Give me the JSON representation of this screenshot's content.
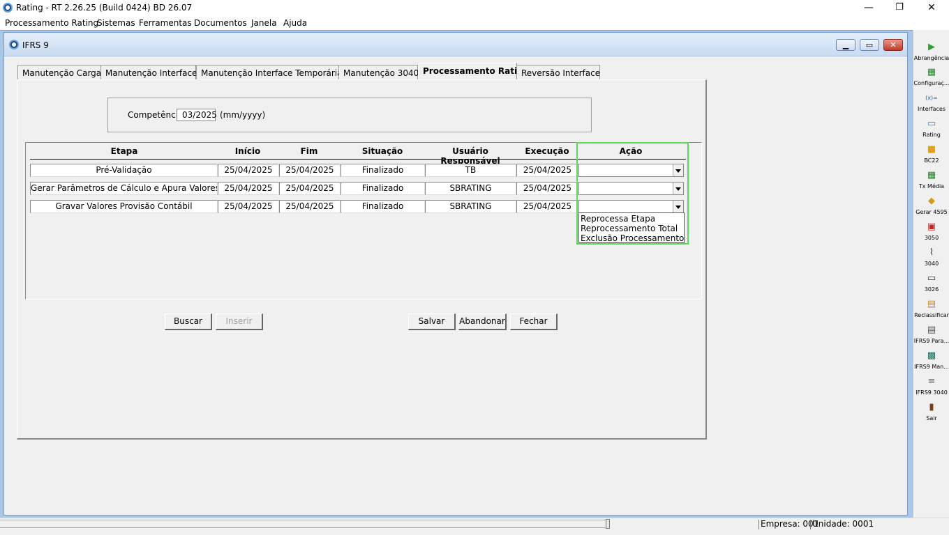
{
  "app": {
    "title": "Rating - RT 2.26.25 (Build 0424) BD 26.07",
    "minimize": "—",
    "maximize": "❐",
    "close": "✕"
  },
  "menu": [
    "Processamento Rating",
    "Sistemas",
    "Ferramentas",
    "Documentos",
    "Janela",
    "Ajuda"
  ],
  "window": {
    "title": "IFRS 9"
  },
  "tabs": [
    "Manutenção Carga",
    "Manutenção Interface",
    "Manutenção Interface Temporária",
    "Manutenção 3040",
    "Processamento Rating",
    "Reversão Interface"
  ],
  "active_tab": "Processamento Rating",
  "competencia": {
    "label": "Competência",
    "value": "03/2025",
    "hint": "(mm/yyyy)"
  },
  "grid": {
    "headers": [
      "Etapa",
      "Início",
      "Fim",
      "Situação",
      "Usuário Responsável",
      "Execução",
      "Ação"
    ],
    "rows": [
      {
        "etapa": "Pré-Validação",
        "inicio": "25/04/2025",
        "fim": "25/04/2025",
        "situacao": "Finalizado",
        "usuario": "TB",
        "execucao": "25/04/2025",
        "acao": ""
      },
      {
        "etapa": "Gerar Parâmetros de Cálculo e Apura Valores de Perda",
        "inicio": "25/04/2025",
        "fim": "25/04/2025",
        "situacao": "Finalizado",
        "usuario": "SBRATING",
        "execucao": "25/04/2025",
        "acao": ""
      },
      {
        "etapa": "Gravar Valores Provisão Contábil",
        "inicio": "25/04/2025",
        "fim": "25/04/2025",
        "situacao": "Finalizado",
        "usuario": "SBRATING",
        "execucao": "25/04/2025",
        "acao": ""
      }
    ],
    "dropdown_options": [
      "Reprocessa Etapa",
      "Reprocessamento Total",
      "Exclusão Processamento"
    ]
  },
  "buttons": {
    "buscar": "Buscar",
    "inserir": "Inserir",
    "salvar": "Salvar",
    "abandonar": "Abandonar",
    "fechar": "Fechar"
  },
  "toolbar": [
    {
      "label": "Abrangência",
      "icon": "abrangencia-icon",
      "glyph": "▶",
      "color": "#3a9a3a"
    },
    {
      "label": "Configuraç...",
      "icon": "configuracao-icon",
      "glyph": "▦",
      "color": "#2e7d32"
    },
    {
      "label": "Interfaces",
      "icon": "interfaces-icon",
      "glyph": "(x)=",
      "color": "#1565c0"
    },
    {
      "label": "Rating",
      "icon": "rating-folder-icon",
      "glyph": "▭",
      "color": "#3f7fd0"
    },
    {
      "label": "BC22",
      "icon": "bc22-cube-icon",
      "glyph": "■",
      "color": "#e0a020"
    },
    {
      "label": "Tx Média",
      "icon": "tx-media-icon",
      "glyph": "▦",
      "color": "#2e7d32"
    },
    {
      "label": "Gerar 4595",
      "icon": "gerar-4595-icon",
      "glyph": "◆",
      "color": "#d49a1a"
    },
    {
      "label": "3050",
      "icon": "3050-icon",
      "glyph": "▣",
      "color": "#c62828"
    },
    {
      "label": "3040",
      "icon": "3040-icon",
      "glyph": "⌇",
      "color": "#333333"
    },
    {
      "label": "3026",
      "icon": "3026-icon",
      "glyph": "▭",
      "color": "#333333"
    },
    {
      "label": "Reclassificar",
      "icon": "reclassificar-icon",
      "glyph": "▤",
      "color": "#d08a1a"
    },
    {
      "label": "IFRS9 Para...",
      "icon": "ifrs9-parametros-icon",
      "glyph": "▤",
      "color": "#555555"
    },
    {
      "label": "IFRS9 Man...",
      "icon": "ifrs9-manutencao-icon",
      "glyph": "▩",
      "color": "#0f6e5a"
    },
    {
      "label": "IFRS9 3040",
      "icon": "ifrs9-3040-icon",
      "glyph": "≡",
      "color": "#777777"
    },
    {
      "label": "Sair",
      "icon": "sair-icon",
      "glyph": "▮",
      "color": "#7a3b1a"
    }
  ],
  "status": {
    "empresa": "Empresa: 001",
    "unidade": "Unidade: 0001"
  }
}
